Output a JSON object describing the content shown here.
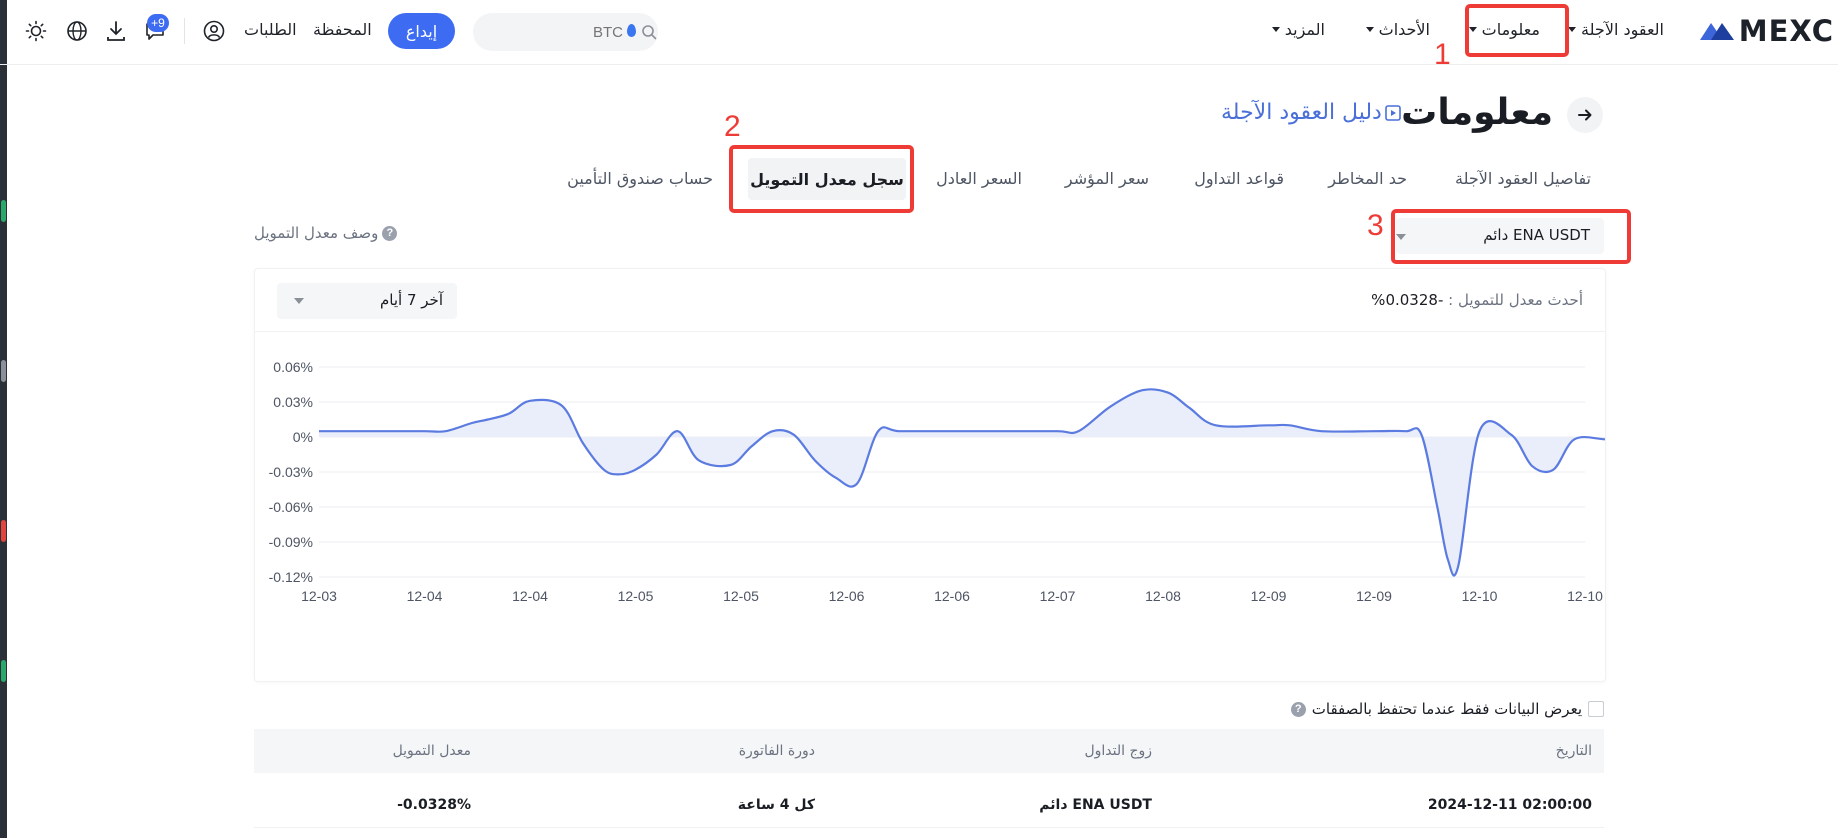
{
  "nav": {
    "logo_text": "MEXC",
    "futures": "العقود الآجلة",
    "info": "معلومات",
    "events": "الأحداث",
    "more": "المزيد",
    "search_placeholder": "BTC",
    "deposit": "إيداع",
    "wallet": "المحفظة",
    "orders": "الطلبات",
    "notifications_badge": "+9"
  },
  "annotations": {
    "n1": "1",
    "n2": "2",
    "n3": "3"
  },
  "page": {
    "title": "معلومات",
    "guide_link": "دليل العقود الآجلة"
  },
  "tabs": [
    {
      "label": "تفاصيل العقود الآجلة"
    },
    {
      "label": "حد المخاطر"
    },
    {
      "label": "قواعد التداول"
    },
    {
      "label": "سعر المؤشر"
    },
    {
      "label": "السعر العادل"
    },
    {
      "label": "سجل معدل التمويل",
      "active": true
    },
    {
      "label": "حساب صندوق التأمين"
    }
  ],
  "controls": {
    "contract": "ENA USDT دائم",
    "description_link": "وصف معدل التمويل",
    "range": "آخر 7 أيام",
    "latest_rate_label": "أحدث معدل للتمويل :",
    "latest_rate_value": "-0.0328%"
  },
  "chart_data": {
    "type": "area",
    "title": "",
    "xlabel": "",
    "ylabel": "",
    "ylim": [
      -0.12,
      0.06
    ],
    "y_ticks": [
      "0.06%",
      "0.03%",
      "0%",
      "-0.03%",
      "-0.06%",
      "-0.09%",
      "-0.12%"
    ],
    "x_tick_labels": [
      "12-03",
      "12-04",
      "12-04",
      "12-05",
      "12-05",
      "12-06",
      "12-06",
      "12-07",
      "12-08",
      "12-09",
      "12-09",
      "12-10",
      "12-10"
    ],
    "grid": true,
    "line_color": "#5b7be0",
    "fill_color": "#e8ecfb",
    "points_x": [
      0,
      0.6,
      1,
      1.2,
      1.45,
      1.6,
      1.8,
      2.0,
      2.3,
      2.5,
      2.7,
      2.85,
      3.0,
      3.2,
      3.4,
      3.6,
      3.9,
      4.1,
      4.3,
      4.5,
      4.7,
      4.9,
      5.1,
      5.3,
      5.5,
      6.0,
      6.5,
      7.0,
      7.2,
      7.5,
      7.8,
      8.05,
      8.25,
      8.5,
      9.0,
      9.2,
      9.5,
      10.0,
      10.3,
      10.45,
      10.6,
      10.7,
      10.8,
      11.0,
      11.3,
      11.5,
      11.7,
      11.9,
      12.2,
      12.5,
      12.7
    ],
    "points_y": [
      0.005,
      0.005,
      0.005,
      0.005,
      0.012,
      0.015,
      0.02,
      0.031,
      0.027,
      -0.005,
      -0.028,
      -0.032,
      -0.028,
      -0.015,
      0.005,
      -0.02,
      -0.024,
      -0.008,
      0.005,
      0.002,
      -0.02,
      -0.035,
      -0.04,
      0.005,
      0.005,
      0.005,
      0.005,
      0.005,
      0.005,
      0.026,
      0.04,
      0.038,
      0.025,
      0.01,
      0.01,
      0.01,
      0.005,
      0.005,
      0.005,
      0.002,
      -0.06,
      -0.105,
      -0.11,
      0.005,
      0.002,
      -0.025,
      -0.028,
      -0.002,
      -0.002,
      -0.002,
      -0.033
    ]
  },
  "table": {
    "filter_label": "يعرض البيانات فقط عندما تحتفظ بالصفقات",
    "headers": {
      "date": "التاريخ",
      "pair": "زوج التداول",
      "cycle": "دورة الفاتورة",
      "rate": "معدل التمويل"
    },
    "rows": [
      {
        "date": "2024-12-11 02:00:00",
        "pair": "ENA USDT دائم",
        "cycle": "كل 4 ساعة",
        "rate": "-0.0328%"
      }
    ]
  }
}
